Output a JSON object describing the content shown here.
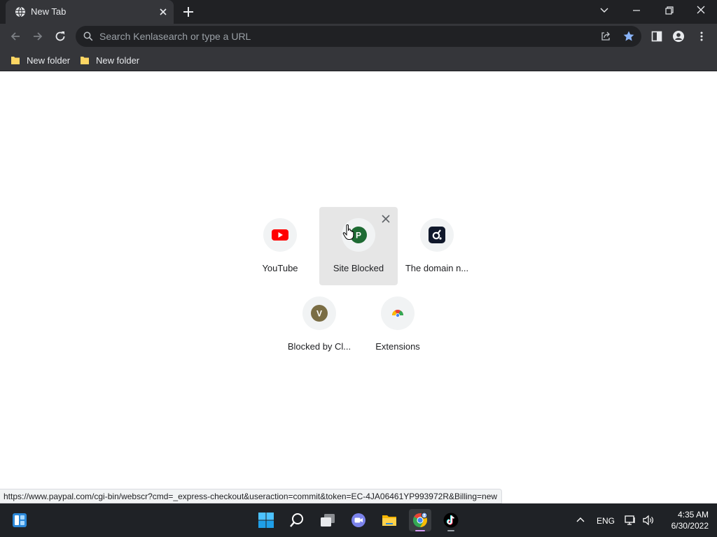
{
  "tab": {
    "title": "New Tab",
    "favicon": "globe-icon"
  },
  "window_controls": [
    "tab-search-icon",
    "minimize-icon",
    "restore-icon",
    "close-icon"
  ],
  "omnibox": {
    "placeholder": "Search Kenlasearch or type a URL"
  },
  "bookmarks": [
    {
      "label": "New folder",
      "icon": "folder-icon"
    },
    {
      "label": "New folder",
      "icon": "folder-icon"
    }
  ],
  "shortcuts": [
    {
      "label": "YouTube",
      "icon": "youtube-icon"
    },
    {
      "label": "Site Blocked",
      "icon": "letter-avatar",
      "letter": "P",
      "color": "#1e6b34",
      "hovered": true
    },
    {
      "label": "The domain n...",
      "icon": "domain-icon"
    },
    {
      "label": "Blocked by Cl...",
      "icon": "letter-avatar",
      "letter": "V",
      "color": "#7a6d44"
    },
    {
      "label": "Extensions",
      "icon": "chrome-icon"
    }
  ],
  "status_url": "https://www.paypal.com/cgi-bin/webscr?cmd=_express-checkout&useraction=commit&token=EC-4JA06461YP993972R&Billing=new",
  "taskbar": {
    "apps": [
      "widgets-icon",
      "start-icon",
      "search-icon",
      "task-view-icon",
      "chat-icon",
      "file-explorer-icon",
      "chrome-icon",
      "tiktok-icon"
    ],
    "language": "ENG",
    "time": "4:35 AM",
    "date": "6/30/2022"
  },
  "colors": {
    "frame": "#202124",
    "toolbar": "#35363a",
    "accent_star": "#8ab4f8"
  }
}
